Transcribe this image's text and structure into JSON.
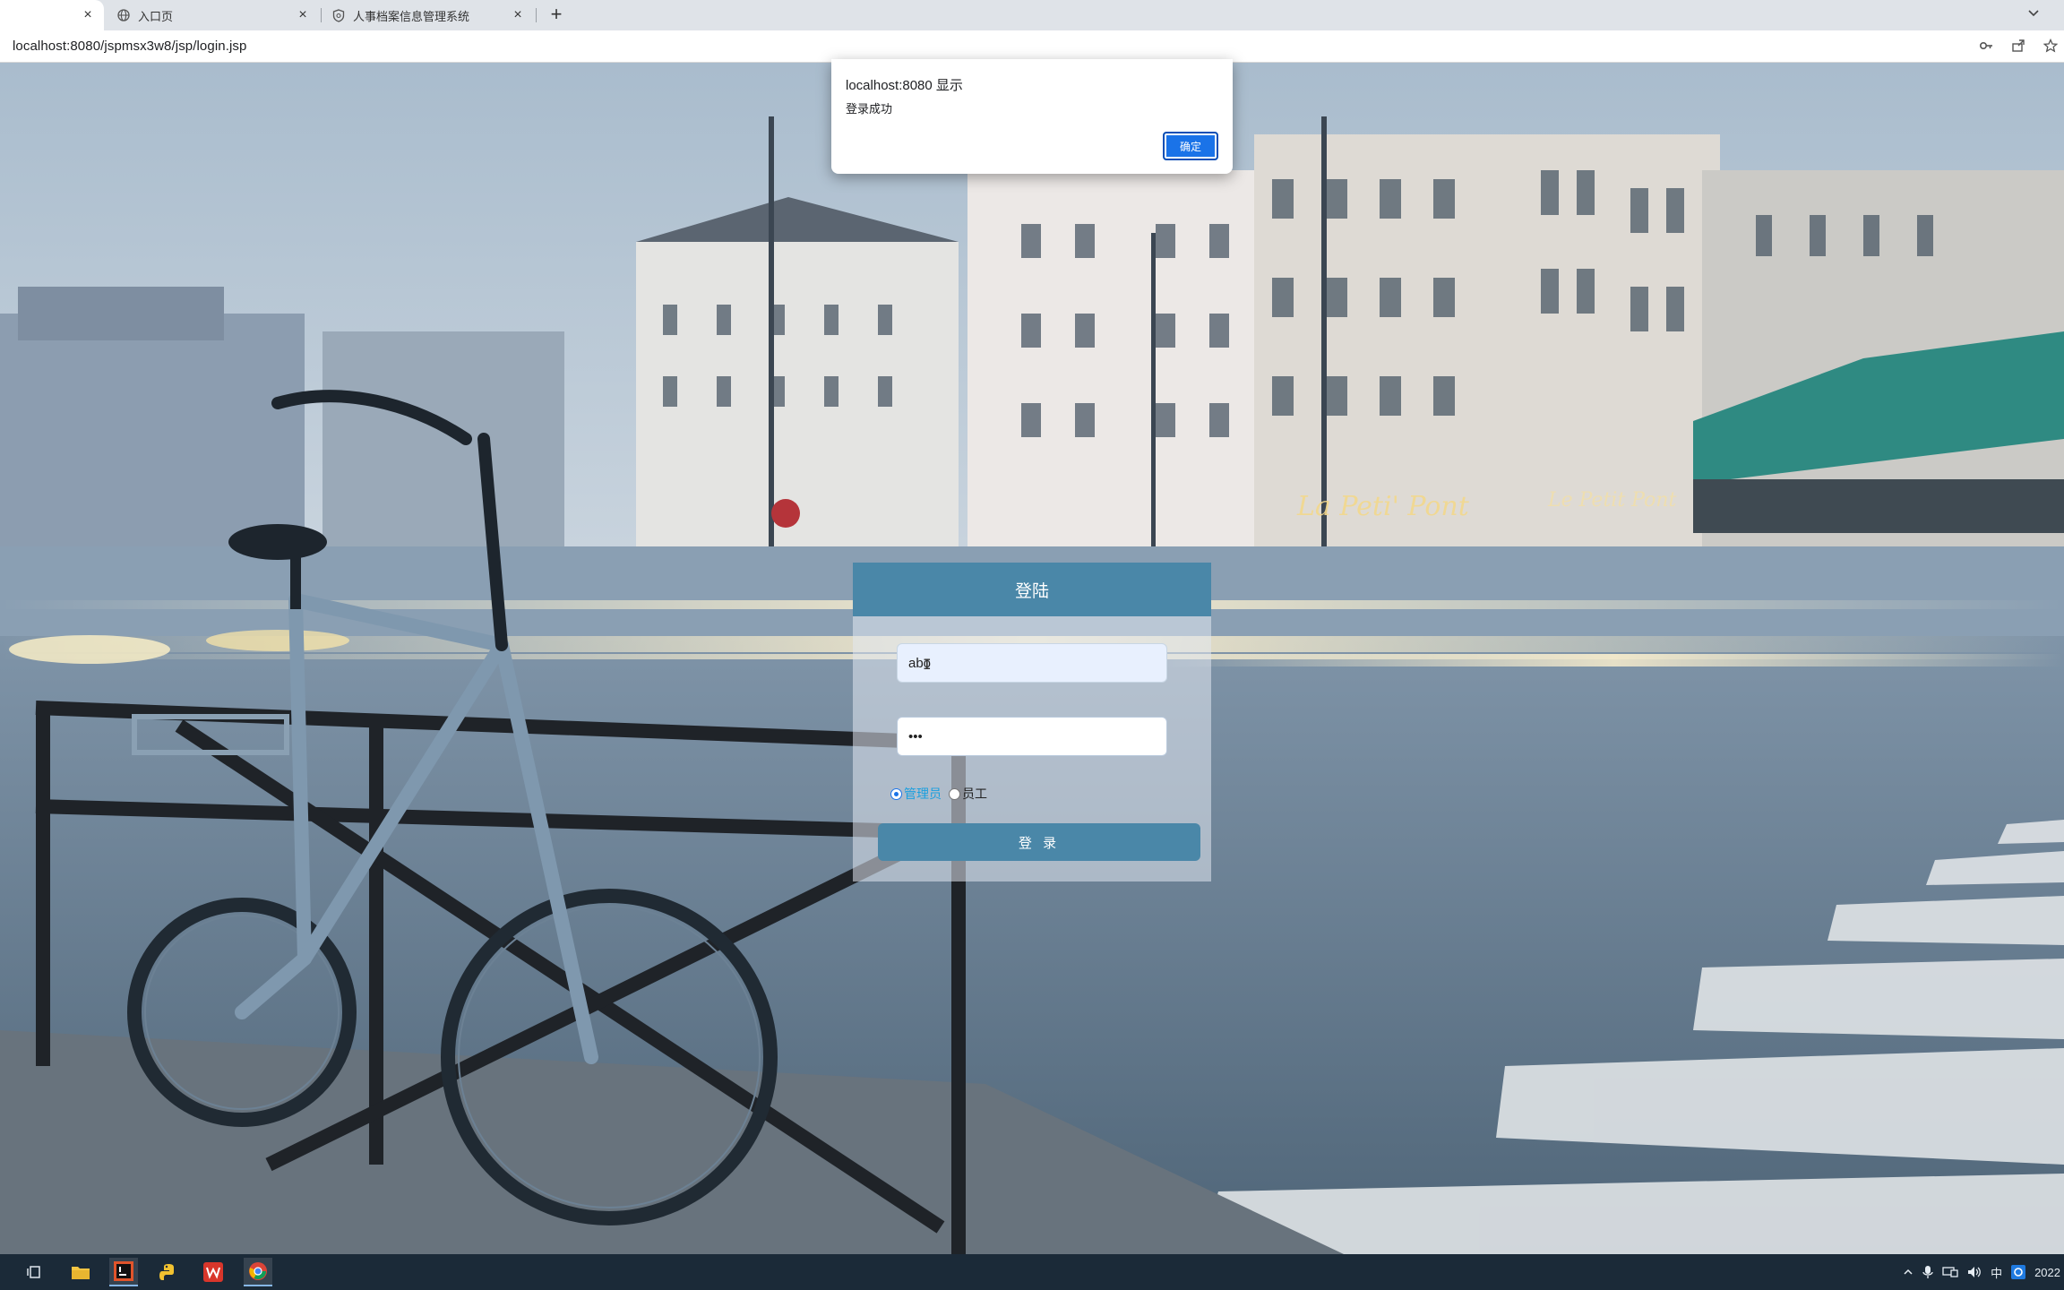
{
  "browser": {
    "tabs": [
      {
        "label": "",
        "icon": "blank-page-icon",
        "active": true
      },
      {
        "label": "入口页",
        "icon": "globe-icon",
        "active": false
      },
      {
        "label": "人事档案信息管理系统",
        "icon": "shield-icon",
        "active": false
      }
    ],
    "new_tab_symbol": "+",
    "url": "localhost:8080/jspmsx3w8/jsp/login.jsp",
    "toolbar_icons": [
      "key-icon",
      "share-icon",
      "star-icon"
    ]
  },
  "dialog": {
    "title": "localhost:8080 显示",
    "message": "登录成功",
    "ok_label": "确定"
  },
  "login": {
    "title": "登陆",
    "username_value": "abo",
    "password_value": "•••",
    "roles": [
      {
        "label": "管理员",
        "checked": true
      },
      {
        "label": "员工",
        "checked": false
      }
    ],
    "submit_label": "登 录"
  },
  "taskbar": {
    "items": [
      "task-view-icon",
      "file-explorer-icon",
      "intellij-icon",
      "python-icon",
      "wps-icon",
      "chrome-icon"
    ],
    "tray": {
      "ime": "中",
      "clock": "2022"
    }
  },
  "colors": {
    "accent": "#4a87a8",
    "dialog_button": "#1a73e8",
    "taskbar": "#1b2a38"
  }
}
